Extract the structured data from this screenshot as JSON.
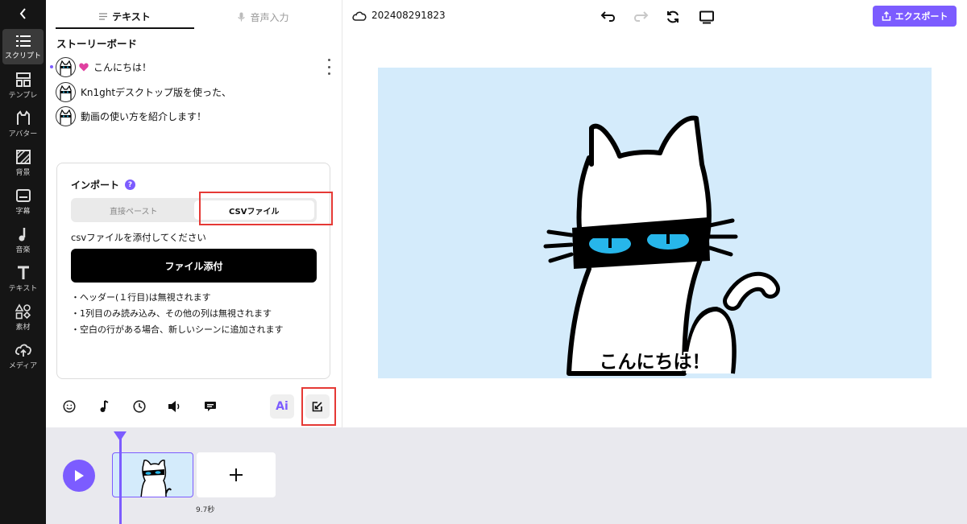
{
  "sidebar": {
    "items": [
      {
        "label": "スクリプト",
        "icon": "script-list-icon",
        "active": true
      },
      {
        "label": "テンプレ",
        "icon": "template-icon"
      },
      {
        "label": "アバター",
        "icon": "avatar-icon"
      },
      {
        "label": "背景",
        "icon": "background-icon"
      },
      {
        "label": "字幕",
        "icon": "subtitle-icon"
      },
      {
        "label": "音楽",
        "icon": "music-icon"
      },
      {
        "label": "テキスト",
        "icon": "text-icon"
      },
      {
        "label": "素材",
        "icon": "material-icon"
      },
      {
        "label": "メディア",
        "icon": "media-upload-icon"
      }
    ]
  },
  "panel": {
    "tabs": [
      {
        "label": "テキスト",
        "active": true
      },
      {
        "label": "音声入力",
        "active": false
      }
    ],
    "storyboard_title": "ストーリーボード",
    "scenes": [
      {
        "text": "こんにちは！"
      },
      {
        "text": "Kn1ghtデスクトップ版を使った、"
      },
      {
        "text": "動画の使い方を紹介します！"
      }
    ],
    "import": {
      "title": "インポート",
      "help": "?",
      "segments": [
        "直接ペースト",
        "CSVファイル"
      ],
      "selected_segment": "CSVファイル",
      "description": "csvファイルを添付してください",
      "attach_label": "ファイル添付",
      "notes": [
        "・ヘッダー(１行目)は無視されます",
        "・1列目のみ読み込み、その他の列は無視されます",
        "・空白の行がある場合、新しいシーンに追加されます"
      ]
    },
    "toolbar": {
      "ai_label": "Ai"
    }
  },
  "topbar": {
    "project_name": "202408291823",
    "export_label": "エクスポート"
  },
  "preview": {
    "caption": "こんにちは！",
    "background_color": "#d4ebfb"
  },
  "timeline": {
    "clip_duration": "9.7秒"
  },
  "colors": {
    "accent": "#7c5cff",
    "highlight": "#e53935"
  }
}
